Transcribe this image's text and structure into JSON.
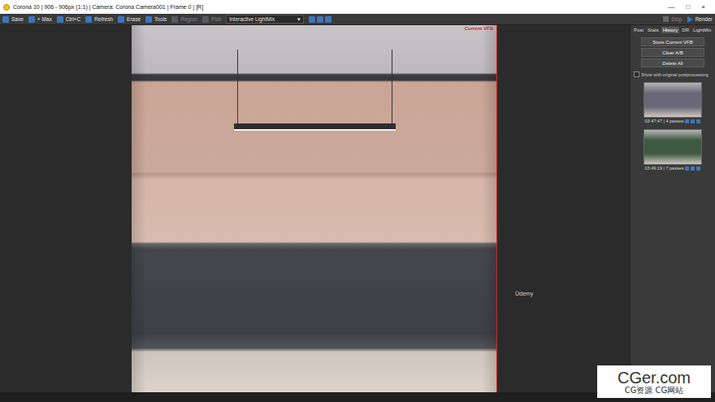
{
  "window": {
    "title": "Corona 10 | 906 - 906px (1:1) | Camera: Corona Camera001 | Frame 0 | [R]",
    "controls": [
      "—",
      "□",
      "×"
    ]
  },
  "toolbar": {
    "buttons": [
      {
        "label": "Save",
        "disabled": false
      },
      {
        "label": "+ Max",
        "disabled": false
      },
      {
        "label": "Ctrl+C",
        "disabled": false
      },
      {
        "label": "Refresh",
        "disabled": false
      },
      {
        "label": "Erase",
        "disabled": false
      },
      {
        "label": "Tools",
        "disabled": false
      },
      {
        "label": "Region",
        "disabled": true
      },
      {
        "label": "Pick",
        "disabled": true
      }
    ],
    "dropdown": {
      "value": "Interactive LightMix",
      "arrow": "▾"
    },
    "actions": [
      {
        "label": "Stop",
        "disabled": true,
        "kind": "stop"
      },
      {
        "label": "Render",
        "disabled": false,
        "kind": "render"
      }
    ]
  },
  "viewport": {
    "label": "Current VFB"
  },
  "overlay_text": "Ūdemy",
  "panel": {
    "tabs": [
      {
        "label": "Post",
        "selected": false
      },
      {
        "label": "Stats",
        "selected": false
      },
      {
        "label": "History",
        "selected": true
      },
      {
        "label": "DR",
        "selected": false
      },
      {
        "label": "LightMix",
        "selected": false
      }
    ],
    "buttons": [
      "Store Current VFB",
      "Clear A/B",
      "Delete All"
    ],
    "checkbox": {
      "label": "Show with original postprocessing",
      "checked": false
    },
    "history": [
      {
        "caption": "03:47:47 | 4 passes",
        "selected": false,
        "color": "#6a6878"
      },
      {
        "caption": "03:49:19 | 7 passes",
        "selected": false,
        "color": "#3f5a42"
      }
    ]
  },
  "watermark": {
    "title": "CGer.com",
    "subtitle": "CG资源 CG网站"
  }
}
